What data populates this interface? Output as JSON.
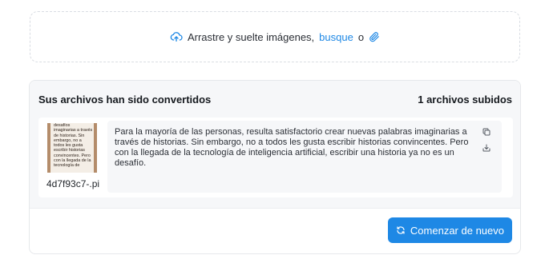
{
  "upload": {
    "prompt": "Arrastre y suelte imágenes,",
    "browse_link": "busque",
    "or": "o",
    "cloud_icon": "cloud-upload-icon",
    "clip_icon": "paperclip-icon"
  },
  "results": {
    "title": "Sus archivos han sido convertidos",
    "count": "1 archivos subidos",
    "files": [
      {
        "thumbnail_lines": [
          "desafíos",
          "imaginarias a través",
          "de historias. Sin",
          "embargo, no a",
          "todos les gusta",
          "escribir historias",
          "convincentes. Pero",
          "con la llegada de la",
          "tecnología de"
        ],
        "name": "4d7f93c7-.pi",
        "text": "Para la mayoría de las personas, resulta satisfactorio crear nuevas palabras imaginarias a través de historias. Sin embargo, no a todos les gusta escribir historias convincentes. Pero con la llegada de la tecnología de inteligencia artificial, escribir una historia ya no es un desafío.",
        "copy_icon": "copy-icon",
        "download_icon": "download-icon"
      }
    ]
  },
  "actions": {
    "restart_label": "Comenzar de nuevo",
    "restart_icon": "refresh-icon"
  },
  "colors": {
    "accent": "#1e88e5"
  }
}
